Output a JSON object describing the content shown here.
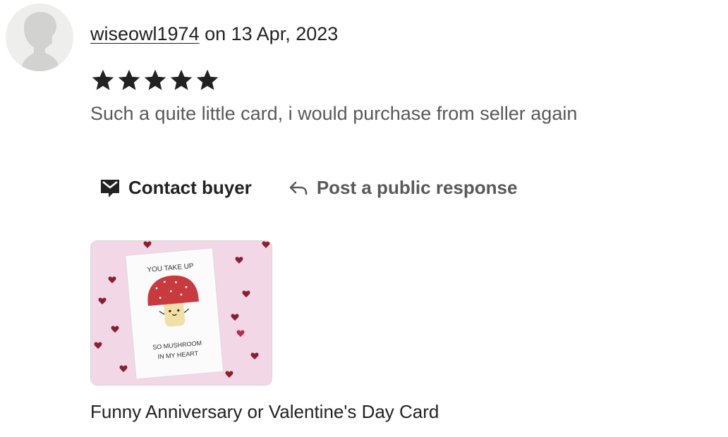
{
  "review": {
    "username": "wiseowl1974",
    "date_text": " on 13 Apr, 2023",
    "rating": 5,
    "rating_max": 5,
    "text": "Such a quite little card, i would purchase from seller again"
  },
  "actions": {
    "contact_label": "Contact buyer",
    "contact_icon": "envelope-icon",
    "public_label": "Post a public response",
    "public_icon": "reply-arrow-icon"
  },
  "listing": {
    "image_text_top": "YOU TAKE UP",
    "image_text_bottom_1": "SO MUSHROOM",
    "image_text_bottom_2": "IN MY HEART",
    "title": "Funny Anniversary or Valentine's Day Card"
  },
  "colors": {
    "text": "#222222",
    "muted": "#595959",
    "thumb_bg": "#f2d7e7",
    "mushroom_cap": "#c83a3e"
  }
}
